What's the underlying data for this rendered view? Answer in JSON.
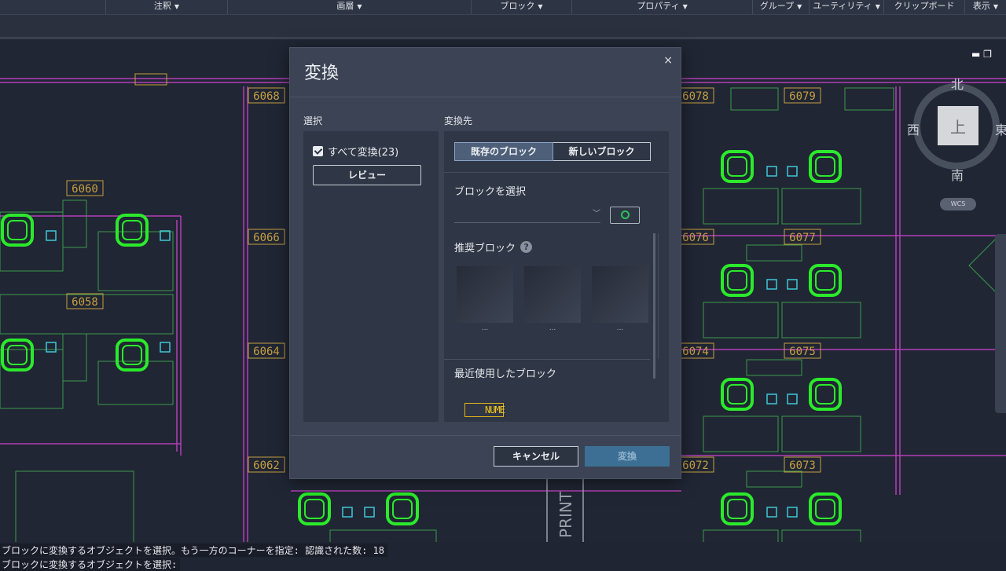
{
  "ribbon": {
    "panels": [
      "注釈",
      "画層",
      "ブロック",
      "プロパティ",
      "グループ",
      "ユーティリティ",
      "クリップボード",
      "表示"
    ]
  },
  "drawing": {
    "room_numbers": [
      "6068",
      "6060",
      "6066",
      "6058",
      "6064",
      "6062",
      "6078",
      "6079",
      "6076",
      "6077",
      "6074",
      "6075",
      "6072",
      "6073"
    ],
    "print_label": "PRINT"
  },
  "viewcube": {
    "north": "北",
    "south": "南",
    "west": "西",
    "east": "東",
    "face": "上",
    "wcs": "WCS"
  },
  "window_controls": {
    "minimize": "▬",
    "restore": "❐"
  },
  "dialog": {
    "title": "変換",
    "close": "×",
    "selection": {
      "label": "選択",
      "convert_all": "すべて変換(23)",
      "convert_all_checked": true,
      "preview_button": "レビュー"
    },
    "target": {
      "label": "変換先",
      "tab_existing": "既存のブロック",
      "tab_new": "新しいブロック",
      "active_tab": "existing",
      "select_block_label": "ブロックを選択",
      "select_block_value": "",
      "recommended_label": "推奨ブロック",
      "recommended_captions": [
        "...",
        "...",
        "..."
      ],
      "recent_label": "最近使用したブロック",
      "recent_block_name": "NUME"
    },
    "cancel_button": "キャンセル",
    "convert_button": "変換"
  },
  "command_line": {
    "line1": "ブロックに変換するオブジェクトを選択。もう一方のコーナーを指定: 認識された数: 18",
    "line2": "ブロックに変換するオブジェクトを選択:"
  },
  "colors": {
    "accent": "#3d6f94",
    "chair": "#2bea2b",
    "room_tag": "#c8a040",
    "partition": "#b23fb6"
  }
}
